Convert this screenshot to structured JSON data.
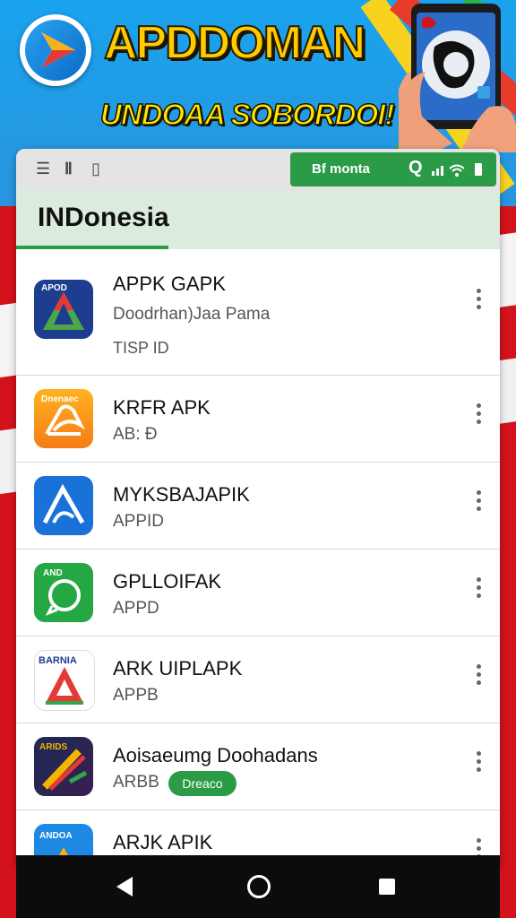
{
  "banner": {
    "title": "APDDOMAN",
    "subtitle": "UNDOAA SOBORDOI!"
  },
  "toolbar": {
    "left_icons": [
      "list-icon",
      "bars-icon",
      "battery-small-icon"
    ],
    "green_label": "Bf monta",
    "search_glyph": "Q"
  },
  "section": {
    "title": "INDonesia"
  },
  "apps": [
    {
      "name": "APPK GAPK",
      "line1": "Doodrhan)Jaa Pama",
      "line2": "TISP ID",
      "icon": "triangle-logo-icon",
      "icon_label": "APOD"
    },
    {
      "name": "KRFR APK",
      "line1": "AB: Đ",
      "icon": "orange-a-icon",
      "icon_label": "Dnenaec"
    },
    {
      "name": "MYKSBAJAPIK",
      "line1": "APPID",
      "icon": "blue-a-icon"
    },
    {
      "name": "GPLLOIFAK",
      "line1": "APPD",
      "icon": "green-chat-icon",
      "icon_label": "AND"
    },
    {
      "name": "ARK UIPLAPK",
      "line1": "APPB",
      "icon": "red-a-icon",
      "icon_label": "BARNIA"
    },
    {
      "name": "Aoisaeumg Doohadans",
      "line1": "ARBB",
      "pill": "Dreaco",
      "icon": "dark-brush-icon",
      "icon_label": "ARIDS"
    },
    {
      "name": "ARJK APIK",
      "line1": "",
      "icon": "blue-partial-icon",
      "icon_label": "ANDOA"
    }
  ],
  "colors": {
    "accent_green": "#2c9b48",
    "banner_yellow": "#ffcc00",
    "flag_red": "#d3121c",
    "sky_blue": "#19a3ee"
  }
}
